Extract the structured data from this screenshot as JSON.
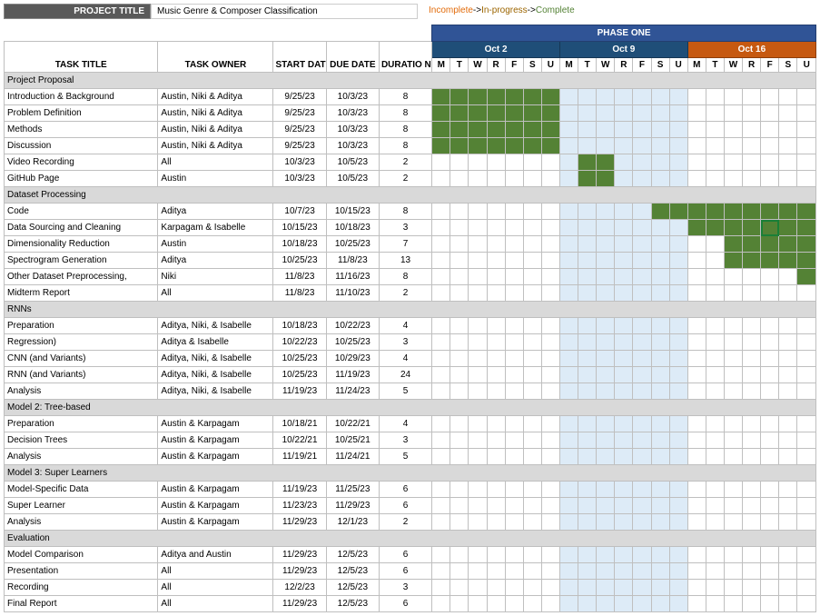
{
  "header": {
    "project_label": "PROJECT TITLE",
    "project_value": "Music Genre & Composer Classification",
    "legend_incomplete": "Incomplete",
    "legend_in_progress": "In-progress",
    "legend_complete": "Complete",
    "arrow": "->"
  },
  "columns": {
    "task_title": "TASK TITLE",
    "task_owner": "TASK OWNER",
    "start_date": "START DATE",
    "due_date": "DUE DATE",
    "duration": "DURATIO N"
  },
  "phase_label": "PHASE ONE",
  "weeks": [
    {
      "label": "Oct 2",
      "style": "blue"
    },
    {
      "label": "Oct 9",
      "style": "blue"
    },
    {
      "label": "Oct 16",
      "style": "orange"
    }
  ],
  "days": [
    "M",
    "T",
    "W",
    "R",
    "F",
    "S",
    "U"
  ],
  "tint_cols": [
    7,
    8,
    9,
    10,
    11,
    12,
    13
  ],
  "selected_cell": {
    "row": 9,
    "col": 18
  },
  "rows": [
    {
      "section": "Project Proposal"
    },
    {
      "task": "Introduction & Background",
      "owner": "Austin, Niki & Aditya",
      "start": "9/25/23",
      "due": "10/3/23",
      "dur": "8",
      "fill": [
        0,
        1,
        2,
        3,
        4,
        5,
        6
      ]
    },
    {
      "task": "Problem Definition",
      "owner": "Austin, Niki & Aditya",
      "start": "9/25/23",
      "due": "10/3/23",
      "dur": "8",
      "fill": [
        0,
        1,
        2,
        3,
        4,
        5,
        6
      ]
    },
    {
      "task": "Methods",
      "owner": "Austin, Niki & Aditya",
      "start": "9/25/23",
      "due": "10/3/23",
      "dur": "8",
      "fill": [
        0,
        1,
        2,
        3,
        4,
        5,
        6
      ]
    },
    {
      "task": "Discussion",
      "owner": "Austin, Niki & Aditya",
      "start": "9/25/23",
      "due": "10/3/23",
      "dur": "8",
      "fill": [
        0,
        1,
        2,
        3,
        4,
        5,
        6
      ]
    },
    {
      "task": "Video Recording",
      "owner": "All",
      "start": "10/3/23",
      "due": "10/5/23",
      "dur": "2",
      "fill": [
        8,
        9
      ]
    },
    {
      "task": "GitHub Page",
      "owner": "Austin",
      "start": "10/3/23",
      "due": "10/5/23",
      "dur": "2",
      "fill": [
        8,
        9
      ]
    },
    {
      "section": "Dataset Processing"
    },
    {
      "task": "Code",
      "owner": "Aditya",
      "start": "10/7/23",
      "due": "10/15/23",
      "dur": "8",
      "fill": [
        12,
        13,
        14,
        15,
        16,
        17,
        18,
        19,
        20
      ]
    },
    {
      "task": "Data Sourcing and Cleaning",
      "owner": "Karpagam & Isabelle",
      "start": "10/15/23",
      "due": "10/18/23",
      "dur": "3",
      "fill": [
        14,
        15,
        16,
        17,
        18,
        19,
        20
      ]
    },
    {
      "task": "Dimensionality Reduction",
      "owner": "Austin",
      "start": "10/18/23",
      "due": "10/25/23",
      "dur": "7",
      "fill": [
        16,
        17,
        18,
        19,
        20
      ]
    },
    {
      "task": "Spectrogram Generation",
      "owner": "Aditya",
      "start": "10/25/23",
      "due": "11/8/23",
      "dur": "13",
      "fill": [
        16,
        17,
        18,
        19,
        20
      ]
    },
    {
      "task": "Other Dataset Preprocessing,",
      "owner": "Niki",
      "start": "11/8/23",
      "due": "11/16/23",
      "dur": "8",
      "fill": [
        20
      ]
    },
    {
      "task": "Midterm Report",
      "owner": "All",
      "start": "11/8/23",
      "due": "11/10/23",
      "dur": "2",
      "fill": []
    },
    {
      "section": "RNNs"
    },
    {
      "task": "Preparation",
      "owner": "Aditya, Niki, & Isabelle",
      "start": "10/18/23",
      "due": "10/22/23",
      "dur": "4",
      "fill": []
    },
    {
      "task": "Regression)",
      "owner": "Aditya & Isabelle",
      "start": "10/22/23",
      "due": "10/25/23",
      "dur": "3",
      "fill": []
    },
    {
      "task": "CNN (and Variants)",
      "owner": "Aditya, Niki, & Isabelle",
      "start": "10/25/23",
      "due": "10/29/23",
      "dur": "4",
      "fill": []
    },
    {
      "task": "RNN (and Variants)",
      "owner": "Aditya, Niki, & Isabelle",
      "start": "10/25/23",
      "due": "11/19/23",
      "dur": "24",
      "fill": []
    },
    {
      "task": "Analysis",
      "owner": "Aditya, Niki, & Isabelle",
      "start": "11/19/23",
      "due": "11/24/23",
      "dur": "5",
      "fill": []
    },
    {
      "section": "Model 2: Tree-based"
    },
    {
      "task": "Preparation",
      "owner": "Austin & Karpagam",
      "start": "10/18/21",
      "due": "10/22/21",
      "dur": "4",
      "fill": []
    },
    {
      "task": "Decision Trees",
      "owner": "Austin & Karpagam",
      "start": "10/22/21",
      "due": "10/25/21",
      "dur": "3",
      "fill": []
    },
    {
      "task": "Analysis",
      "owner": "Austin & Karpagam",
      "start": "11/19/21",
      "due": "11/24/21",
      "dur": "5",
      "fill": []
    },
    {
      "section": "Model 3: Super Learners"
    },
    {
      "task": "Model-Specific Data",
      "owner": "Austin & Karpagam",
      "start": "11/19/23",
      "due": "11/25/23",
      "dur": "6",
      "fill": []
    },
    {
      "task": "Super Learner",
      "owner": "Austin & Karpagam",
      "start": "11/23/23",
      "due": "11/29/23",
      "dur": "6",
      "fill": []
    },
    {
      "task": "Analysis",
      "owner": "Austin & Karpagam",
      "start": "11/29/23",
      "due": "12/1/23",
      "dur": "2",
      "fill": []
    },
    {
      "section": "Evaluation"
    },
    {
      "task": "Model Comparison",
      "owner": "Aditya and Austin",
      "start": "11/29/23",
      "due": "12/5/23",
      "dur": "6",
      "fill": []
    },
    {
      "task": "Presentation",
      "owner": "All",
      "start": "11/29/23",
      "due": "12/5/23",
      "dur": "6",
      "fill": []
    },
    {
      "task": "Recording",
      "owner": "All",
      "start": "12/2/23",
      "due": "12/5/23",
      "dur": "3",
      "fill": []
    },
    {
      "task": "Final Report",
      "owner": "All",
      "start": "11/29/23",
      "due": "12/5/23",
      "dur": "6",
      "fill": []
    }
  ]
}
